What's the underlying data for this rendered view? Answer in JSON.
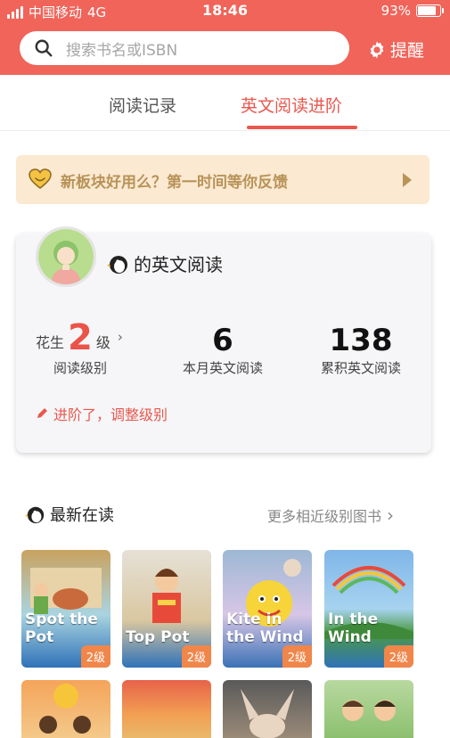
{
  "status_bar": {
    "carrier": "中国移动",
    "network": "4G",
    "time": "18:46",
    "battery_percent": "93%",
    "battery_level": 0.93
  },
  "header": {
    "search_placeholder": "搜索书名或ISBN",
    "remind_label": "提醒",
    "search_icon": "search-icon",
    "gear_icon": "gear-icon"
  },
  "tabs": [
    {
      "label": "阅读记录",
      "active": false
    },
    {
      "label": "英文阅读进阶",
      "active": true
    }
  ],
  "banner": {
    "text": "新板块好用么？第一时间等你反馈",
    "icon": "heart-icon"
  },
  "card": {
    "title": "的英文阅读",
    "level_prefix": "花生",
    "level_value": "2",
    "level_suffix": "级",
    "level_label": "阅读级别",
    "month_count": "6",
    "month_label": "本月英文阅读",
    "total_count": "138",
    "total_label": "累积英文阅读",
    "adjust_label": "进阶了，调整级别"
  },
  "latest": {
    "title": "最新在读",
    "more_label": "更多相近级别图书"
  },
  "books": [
    {
      "title": "Spot the Pot",
      "badge": "2级"
    },
    {
      "title": "Top Pot",
      "badge": "2级"
    },
    {
      "title": "Kite in the Wind",
      "badge": "2级"
    },
    {
      "title": "In the Wind",
      "badge": "2级"
    }
  ],
  "colors": {
    "brand": "#f0645a",
    "accent": "#e8584e",
    "banner_bg": "#fbe9d2",
    "badge": "#f0864a"
  }
}
